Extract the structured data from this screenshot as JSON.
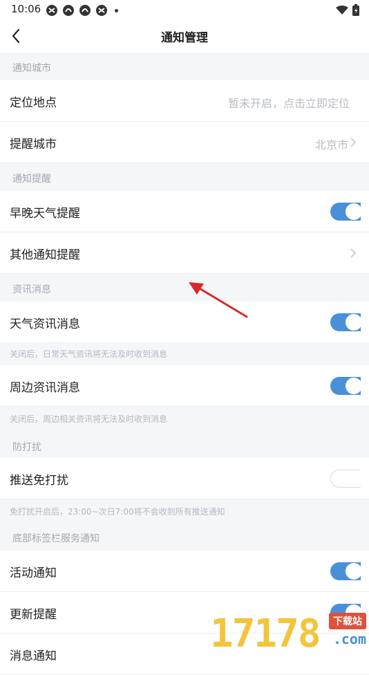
{
  "status_bar": {
    "time": "10:06",
    "icons": [
      "notification-icon-1",
      "notification-icon-2",
      "notification-icon-3",
      "notification-icon-4"
    ],
    "right_icons": [
      "wifi-icon",
      "battery-icon"
    ]
  },
  "header": {
    "title": "通知管理"
  },
  "sections": {
    "city": {
      "title": "通知城市",
      "location_label": "定位地点",
      "location_value": "暂未开启，点击立即定位",
      "reminder_city_label": "提醒城市",
      "reminder_city_value": "北京市"
    },
    "reminder": {
      "title": "通知提醒",
      "morning_evening_label": "早晚天气提醒",
      "morning_evening_on": true,
      "other_label": "其他通知提醒"
    },
    "news": {
      "title": "资讯消息",
      "weather_news_label": "天气资讯消息",
      "weather_news_on": true,
      "weather_news_hint": "关闭后，日常天气资讯将无法及时收到消息",
      "nearby_news_label": "周边资讯消息",
      "nearby_news_on": true,
      "nearby_news_hint": "关闭后，周边相关资讯将无法及时收到消息"
    },
    "dnd": {
      "title": "防打扰",
      "push_dnd_label": "推送免打扰",
      "push_dnd_on": false,
      "push_dnd_hint": "免打扰开启后，23:00~次日7:00将不会收到所有推送通知"
    },
    "tabbar": {
      "title": "底部标签栏服务通知",
      "activity_label": "活动通知",
      "activity_on": true,
      "update_label": "更新提醒",
      "update_on": true,
      "message_label": "消息通知"
    }
  },
  "colors": {
    "toggle_on": "#4a90d9",
    "background": "#f5f6f8",
    "annotation_arrow": "#d62a2a"
  },
  "watermark": {
    "digits": "17178",
    "badge": "下载站",
    "sub": ".com"
  }
}
